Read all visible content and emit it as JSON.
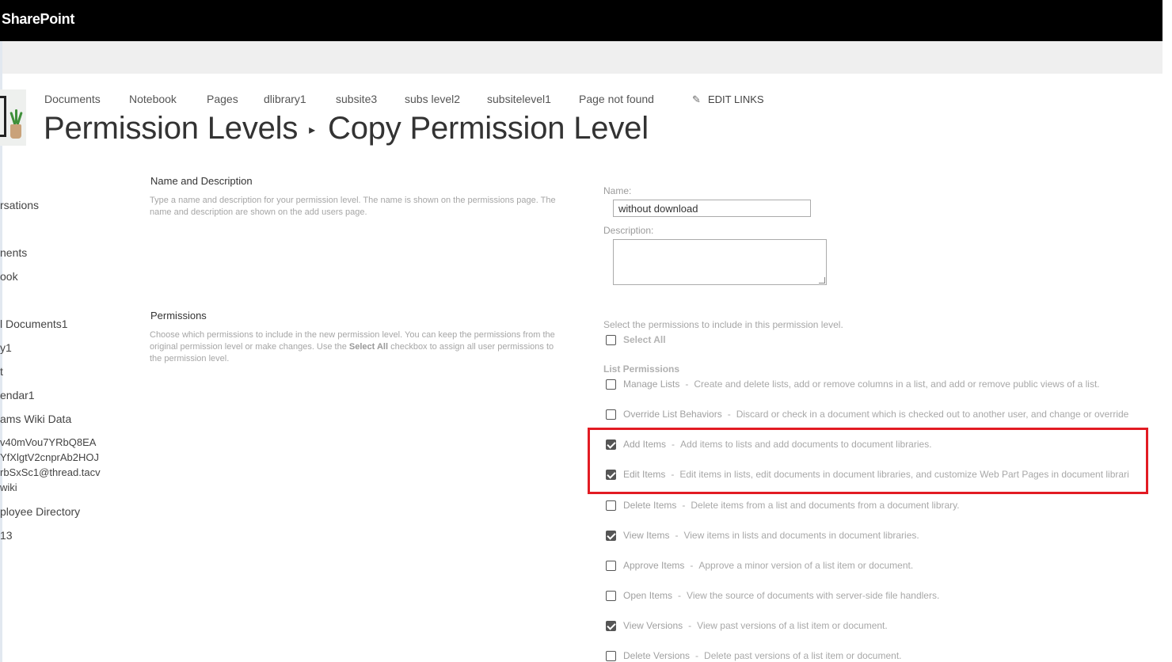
{
  "suitebar": {
    "brand": "SharePoint"
  },
  "topnav": {
    "links": [
      "Documents",
      "Notebook",
      "Pages",
      "dlibrary1",
      "subsite3",
      "subs level2",
      "subsitelevel1",
      "Page not found"
    ],
    "edit_links": "EDIT LINKS"
  },
  "title": {
    "parent": "Permission Levels",
    "current": "Copy Permission Level",
    "separator": "▸"
  },
  "quicklaunch": {
    "items": [
      "rsations",
      "nents",
      "ook",
      "l Documents1",
      "y1",
      "t",
      "endar1",
      "ams Wiki Data",
      "v40mVou7YRbQ8EA",
      "YfXlgtV2cnprAb2HOJ",
      "rbSxSc1@thread.tacv",
      "wiki",
      "ployee Directory",
      "13"
    ]
  },
  "name_section": {
    "title": "Name and Description",
    "desc": "Type a name and description for your permission level.  The name is shown on the permissions page. The name and description are shown on the add users page.",
    "name_label": "Name:",
    "name_value": "without download",
    "description_label": "Description:"
  },
  "perm_section": {
    "title": "Permissions",
    "desc_before": "Choose which permissions to include in the new permission level.  You can keep the permissions from the original permission level or make changes.  Use the ",
    "desc_bold": "Select All",
    "desc_after": " checkbox to assign all user permissions to the permission level.",
    "intro": "Select the permissions to include in this permission level.",
    "select_all": {
      "label": "Select All",
      "checked": false
    },
    "group_heading": "List Permissions",
    "items": [
      {
        "name": "Manage Lists",
        "desc": "Create and delete lists, add or remove columns in a list, and add or remove public views of a list.",
        "checked": false
      },
      {
        "name": "Override List Behaviors",
        "desc": "Discard or check in a document which is checked out to another user, and change or override",
        "checked": false
      },
      {
        "name": "Add Items",
        "desc": "Add items to lists and add documents to document libraries.",
        "checked": true
      },
      {
        "name": "Edit Items",
        "desc": "Edit items in lists, edit documents in document libraries, and customize Web Part Pages in document librari",
        "checked": true
      },
      {
        "name": "Delete Items",
        "desc": "Delete items from a list and documents from a document library.",
        "checked": false
      },
      {
        "name": "View Items",
        "desc": "View items in lists and documents in document libraries.",
        "checked": true
      },
      {
        "name": "Approve Items",
        "desc": "Approve a minor version of a list item or document.",
        "checked": false
      },
      {
        "name": "Open Items",
        "desc": "View the source of documents with server-side file handlers.",
        "checked": false
      },
      {
        "name": "View Versions",
        "desc": "View past versions of a list item or document.",
        "checked": true
      },
      {
        "name": "Delete Versions",
        "desc": "Delete past versions of a list item or document.",
        "checked": false
      }
    ]
  },
  "colors": {
    "highlight": "#e21b23",
    "suitebar": "#000000"
  }
}
